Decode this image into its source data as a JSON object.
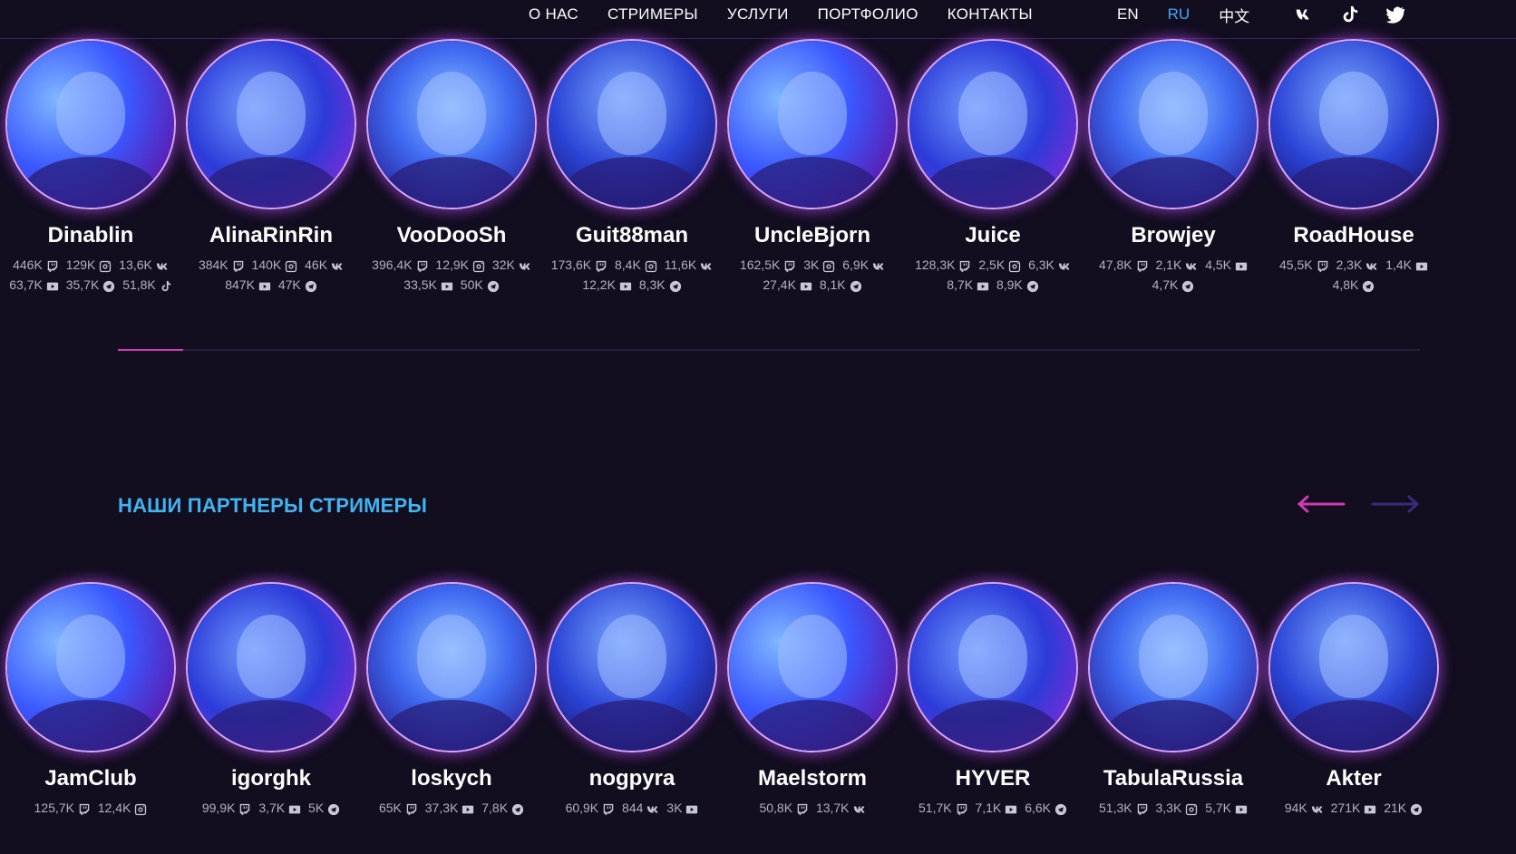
{
  "nav": {
    "links": [
      "О НАС",
      "СТРИМЕРЫ",
      "УСЛУГИ",
      "ПОРТФОЛИО",
      "КОНТАКТЫ"
    ],
    "languages": [
      {
        "label": "EN",
        "active": false
      },
      {
        "label": "RU",
        "active": true
      },
      {
        "label": "中文",
        "active": false
      }
    ],
    "socials": [
      "vk-icon",
      "tiktok-icon",
      "twitter-icon"
    ]
  },
  "colors": {
    "background": "#120d1f",
    "accent_blue": "#3fb4f0",
    "accent_pink": "#d03ab5",
    "active_lang": "#3fa8ff"
  },
  "streamers": [
    {
      "name": "Dinablin",
      "stats": [
        [
          "446K",
          "twitch"
        ],
        [
          "129K",
          "instagram"
        ],
        [
          "13,6K",
          "vk"
        ],
        [
          "63,7K",
          "youtube"
        ],
        [
          "35,7K",
          "telegram"
        ],
        [
          "51,8K",
          "tiktok"
        ]
      ]
    },
    {
      "name": "AlinaRinRin",
      "stats": [
        [
          "384K",
          "twitch"
        ],
        [
          "140K",
          "instagram"
        ],
        [
          "46K",
          "vk"
        ],
        [
          "847K",
          "youtube"
        ],
        [
          "47K",
          "telegram"
        ]
      ]
    },
    {
      "name": "VooDooSh",
      "stats": [
        [
          "396,4K",
          "twitch"
        ],
        [
          "12,9K",
          "instagram"
        ],
        [
          "32K",
          "vk"
        ],
        [
          "33,5K",
          "youtube"
        ],
        [
          "50K",
          "telegram"
        ]
      ]
    },
    {
      "name": "Guit88man",
      "stats": [
        [
          "173,6K",
          "twitch"
        ],
        [
          "8,4K",
          "instagram"
        ],
        [
          "11,6K",
          "vk"
        ],
        [
          "12,2K",
          "youtube"
        ],
        [
          "8,3K",
          "telegram"
        ]
      ]
    },
    {
      "name": "UncleBjorn",
      "stats": [
        [
          "162,5K",
          "twitch"
        ],
        [
          "3K",
          "instagram"
        ],
        [
          "6,9K",
          "vk"
        ],
        [
          "27,4K",
          "youtube"
        ],
        [
          "8,1K",
          "telegram"
        ]
      ]
    },
    {
      "name": "Juice",
      "stats": [
        [
          "128,3K",
          "twitch"
        ],
        [
          "2,5K",
          "instagram"
        ],
        [
          "6,3K",
          "vk"
        ],
        [
          "8,7K",
          "youtube"
        ],
        [
          "8,9K",
          "telegram"
        ]
      ]
    },
    {
      "name": "Browjey",
      "stats": [
        [
          "47,8K",
          "twitch"
        ],
        [
          "2,1K",
          "vk"
        ],
        [
          "4,5K",
          "youtube"
        ],
        [
          "4,7K",
          "telegram"
        ]
      ]
    },
    {
      "name": "RoadHouse",
      "stats": [
        [
          "45,5K",
          "twitch"
        ],
        [
          "2,3K",
          "vk"
        ],
        [
          "1,4K",
          "youtube"
        ],
        [
          "4,8K",
          "telegram"
        ]
      ]
    }
  ],
  "partners_title": "НАШИ ПАРТНЕРЫ СТРИМЕРЫ",
  "partners": [
    {
      "name": "JamClub",
      "stats": [
        [
          "125,7K",
          "twitch"
        ],
        [
          "12,4K",
          "instagram"
        ]
      ]
    },
    {
      "name": "igorghk",
      "stats": [
        [
          "99,9K",
          "twitch"
        ],
        [
          "3,7K",
          "youtube"
        ],
        [
          "5K",
          "telegram"
        ]
      ]
    },
    {
      "name": "loskych",
      "stats": [
        [
          "65K",
          "twitch"
        ],
        [
          "37,3K",
          "youtube"
        ],
        [
          "7,8K",
          "telegram"
        ]
      ]
    },
    {
      "name": "nogpyra",
      "stats": [
        [
          "60,9K",
          "twitch"
        ],
        [
          "844",
          "vk"
        ],
        [
          "3K",
          "youtube"
        ]
      ]
    },
    {
      "name": "Maelstorm",
      "stats": [
        [
          "50,8K",
          "twitch"
        ],
        [
          "13,7K",
          "vk"
        ]
      ]
    },
    {
      "name": "HYVER",
      "stats": [
        [
          "51,7K",
          "twitch"
        ],
        [
          "7,1K",
          "youtube"
        ],
        [
          "6,6K",
          "telegram"
        ]
      ]
    },
    {
      "name": "TabulaRussia",
      "stats": [
        [
          "51,3K",
          "twitch"
        ],
        [
          "3,3K",
          "instagram"
        ],
        [
          "5,7K",
          "youtube"
        ]
      ]
    },
    {
      "name": "Akter",
      "stats": [
        [
          "94K",
          "vk"
        ],
        [
          "271K",
          "youtube"
        ],
        [
          "21K",
          "telegram"
        ]
      ]
    }
  ]
}
